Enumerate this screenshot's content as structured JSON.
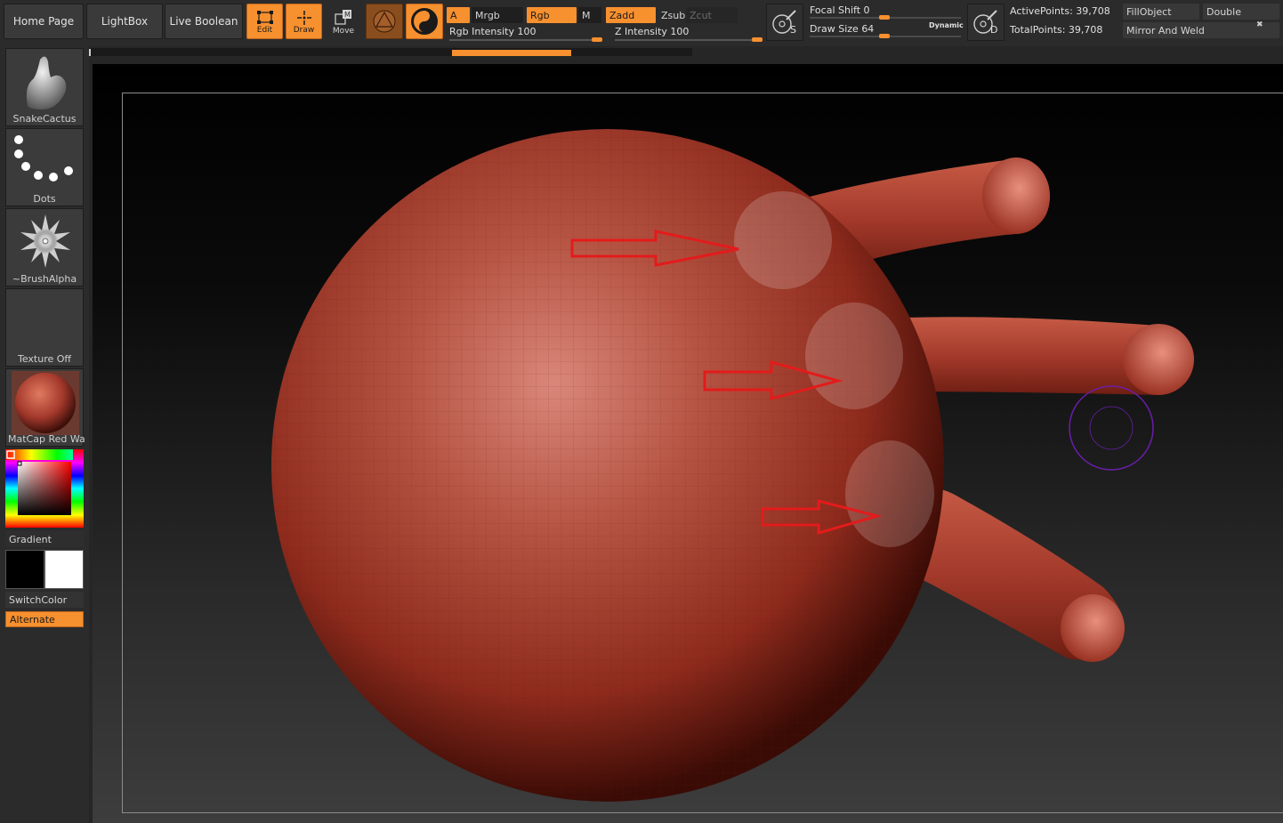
{
  "nav": {
    "home_page": "Home Page",
    "lightbox": "LightBox",
    "live_boolean": "Live Boolean"
  },
  "tools": {
    "edit": "Edit",
    "draw": "Draw",
    "move": "Move"
  },
  "modes": {
    "a": "A",
    "mrgb": "Mrgb",
    "rgb": "Rgb",
    "m": "M",
    "zadd": "Zadd",
    "zsub": "Zsub",
    "zcut": "Zcut",
    "rgb_intensity_label": "Rgb Intensity",
    "rgb_intensity_value": "100",
    "rgb_intensity_level": 1.0,
    "z_intensity_label": "Z Intensity",
    "z_intensity_value": "100",
    "z_intensity_level": 1.0
  },
  "brush_settings": {
    "focal_shift_label": "Focal Shift",
    "focal_shift_value": "0",
    "draw_size_label": "Draw Size",
    "draw_size_value": "64",
    "dynamic_label": "Dynamic",
    "lightbox_s": "S",
    "lightbox_d": "D"
  },
  "stats": {
    "active_points": "ActivePoints: 39,708",
    "total_points": "TotalPoints: 39,708"
  },
  "right_buttons": {
    "fill_object": "FillObject",
    "double": "Double",
    "mirror_weld": "Mirror And Weld"
  },
  "left_panel": {
    "brush": "SnakeCactus",
    "stroke": "Dots",
    "alpha": "~BrushAlpha",
    "texture": "Texture Off",
    "material": "MatCap Red Wax",
    "gradient": "Gradient",
    "switch_color": "SwitchColor",
    "alternate": "Alternate"
  },
  "colors": {
    "accent": "#f7902f",
    "panel": "#2b2b2b",
    "sculpt_red": "#a4392c",
    "arrow_red": "#e31b1b",
    "brush_cursor": "#6a1ea8"
  }
}
